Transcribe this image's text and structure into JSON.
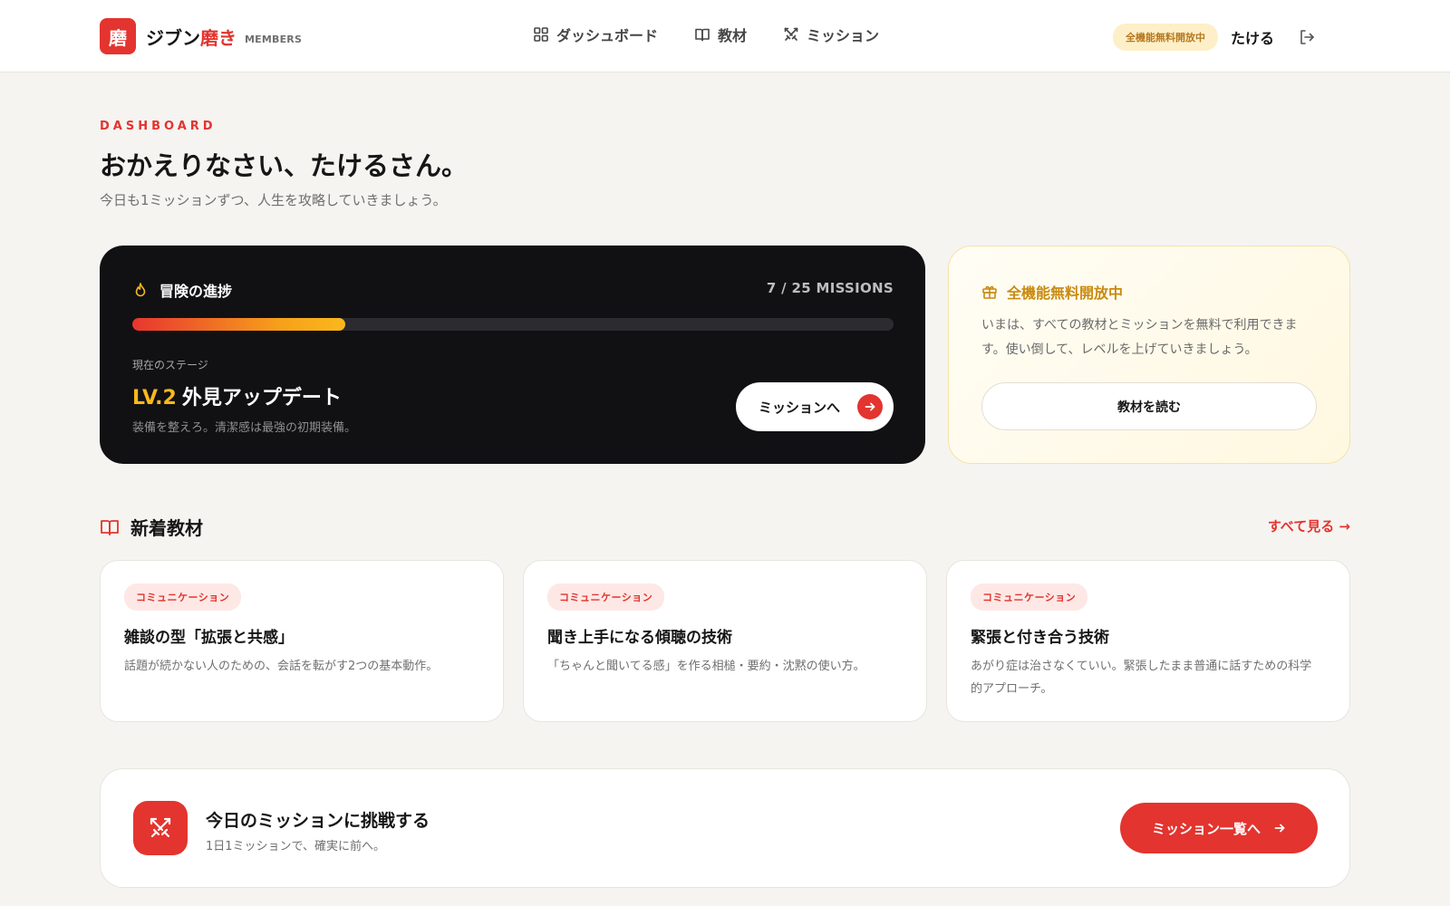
{
  "header": {
    "logo_char": "磨",
    "brand_main": "ジブン",
    "brand_accent": "磨き",
    "brand_sub": "MEMBERS",
    "nav": [
      {
        "label": "ダッシュボード",
        "icon": "grid-icon"
      },
      {
        "label": "教材",
        "icon": "book-icon"
      },
      {
        "label": "ミッション",
        "icon": "swords-icon"
      }
    ],
    "badge": "全機能無料開放中",
    "user_name": "たける",
    "logout_icon": "logout-icon"
  },
  "page": {
    "eyebrow": "DASHBOARD",
    "title": "おかえりなさい、たけるさん。",
    "subtitle": "今日も1ミッションずつ、人生を攻略していきましょう。"
  },
  "progress": {
    "title": "冒険の進捗",
    "icon": "flame-icon",
    "count": "7 / 25 MISSIONS",
    "completed": 7,
    "total": 25,
    "stage_label": "現在のステージ",
    "stage_level": "LV.2",
    "stage_name": "外見アップデート",
    "stage_desc": "装備を整えろ。清潔感は最強の初期装備。",
    "button_label": "ミッションへ"
  },
  "free_card": {
    "icon": "gift-icon",
    "title": "全機能無料開放中",
    "text": "いまは、すべての教材とミッションを無料で利用できます。使い倒して、レベルを上げていきましょう。",
    "button_label": "教材を読む"
  },
  "materials": {
    "title": "新着教材",
    "see_all": "すべて見る →",
    "items": [
      {
        "tag": "コミュニケーション",
        "title": "雑談の型「拡張と共感」",
        "desc": "話題が続かない人のための、会話を転がす2つの基本動作。"
      },
      {
        "tag": "コミュニケーション",
        "title": "聞き上手になる傾聴の技術",
        "desc": "「ちゃんと聞いてる感」を作る相槌・要約・沈黙の使い方。"
      },
      {
        "tag": "コミュニケーション",
        "title": "緊張と付き合う技術",
        "desc": "あがり症は治さなくていい。緊張したまま普通に話すための科学的アプローチ。"
      }
    ]
  },
  "challenge": {
    "icon": "swords-icon",
    "title": "今日のミッションに挑戦する",
    "subtitle": "1日1ミッションで、確実に前へ。",
    "button_label": "ミッション一覧へ"
  },
  "colors": {
    "accent": "#e3342f",
    "gold": "#fbb81c",
    "dark": "#111114"
  }
}
